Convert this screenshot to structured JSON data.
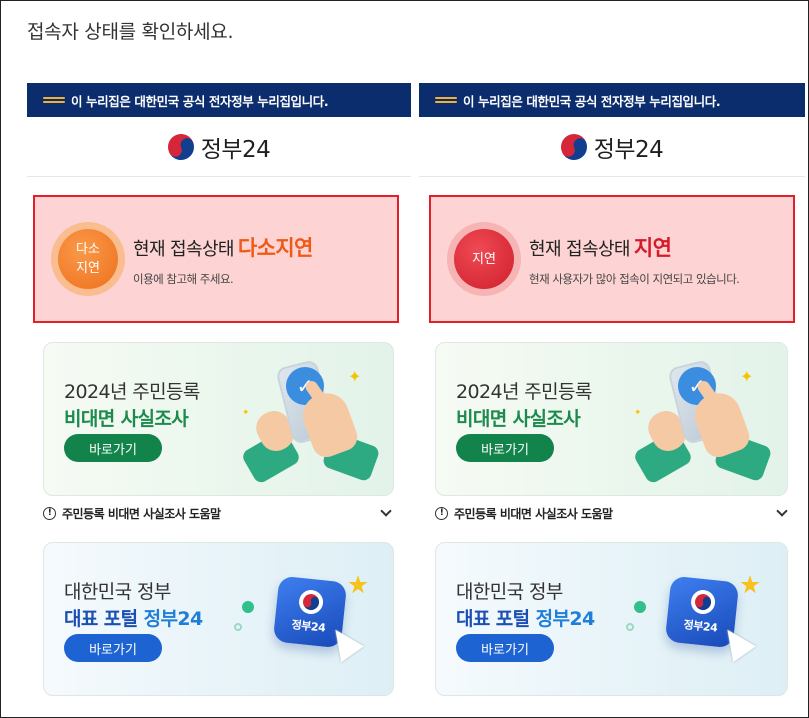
{
  "page_title": "접속자 상태를 확인하세요.",
  "gov_banner": "이 누리집은 대한민국 공식 전자정부 누리집입니다.",
  "logo_text": "정부24",
  "panels": [
    {
      "status_circle_line1": "다소",
      "status_circle_line2": "지연",
      "status_prefix": "현재 접속상태",
      "status_value": "다소지연",
      "status_sub": "이용에 참고해 주세요.",
      "color": "#ef5a18"
    },
    {
      "status_circle_line1": "지연",
      "status_circle_line2": "",
      "status_prefix": "현재 접속상태",
      "status_value": "지연",
      "status_sub": "현재 사용자가 많아 접속이 지연되고 있습니다.",
      "color": "#d61a2a"
    }
  ],
  "card1": {
    "line1": "2024년 주민등록",
    "line2": "비대면 사실조사",
    "button": "바로가기"
  },
  "help": {
    "icon": "!",
    "text": "주민등록 비대면 사실조사 도움말"
  },
  "card2": {
    "line1": "대한민국 정부",
    "line2_a": "대표 포털 ",
    "line2_b": "정부24",
    "button": "바로가기",
    "app_label": "정부24"
  },
  "icons": {
    "eg": "eg-mark-icon",
    "logo": "taegeuk-logo-icon",
    "help": "info-icon",
    "chevron": "chevron-down-icon",
    "check": "check-icon",
    "cursor": "cursor-icon",
    "star": "star-icon",
    "sparkle": "sparkle-icon"
  }
}
